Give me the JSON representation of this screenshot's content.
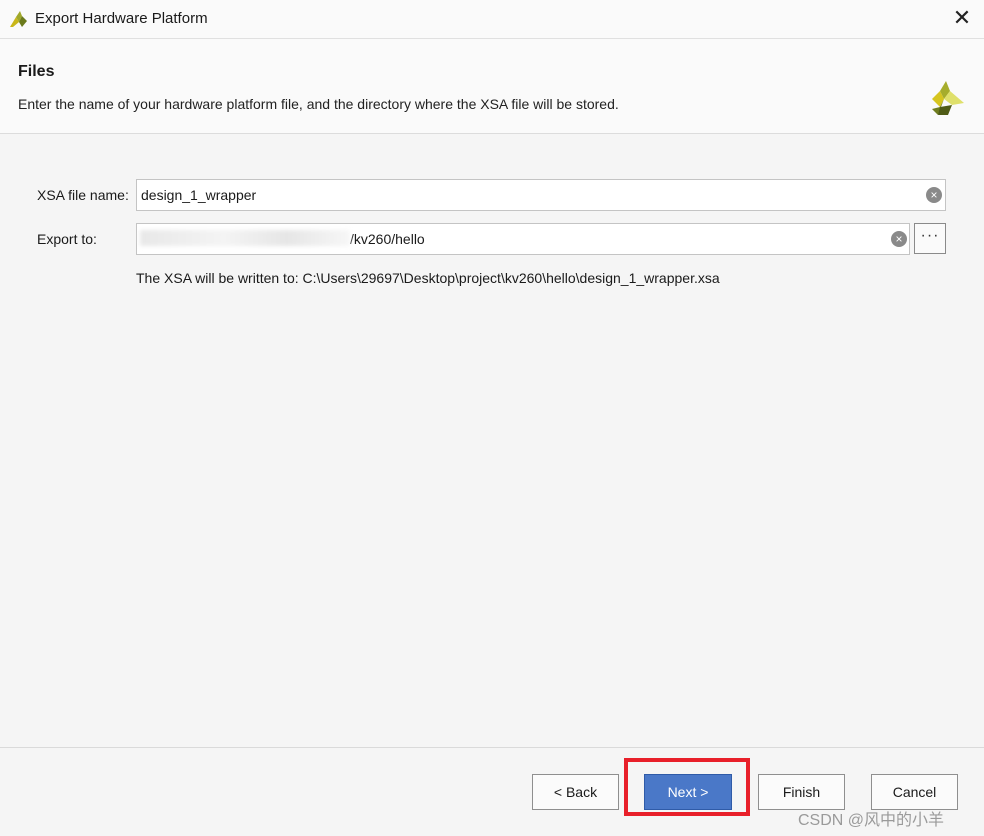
{
  "window": {
    "title": "Export Hardware Platform",
    "close_glyph": "✕"
  },
  "header": {
    "title": "Files",
    "description": "Enter the name of your hardware platform file, and the directory where the XSA file will be stored."
  },
  "form": {
    "xsa_label": "XSA file name:",
    "xsa_value": "design_1_wrapper",
    "export_label": "Export to:",
    "export_value": "/kv260/hello",
    "browse_label": "···",
    "note": "The XSA will be written to: C:\\Users\\29697\\Desktop\\project\\kv260\\hello\\design_1_wrapper.xsa"
  },
  "buttons": {
    "back": "< Back",
    "next": "Next >",
    "finish": "Finish",
    "cancel": "Cancel"
  },
  "watermark": "CSDN @风中的小羊",
  "colors": {
    "primary": "#4a78c8",
    "highlight": "#e8202a",
    "logo_green": "#8a9a2b"
  },
  "icons": {
    "app": "xilinx-logo-icon",
    "clear": "clear-icon",
    "browse": "ellipsis-icon"
  }
}
